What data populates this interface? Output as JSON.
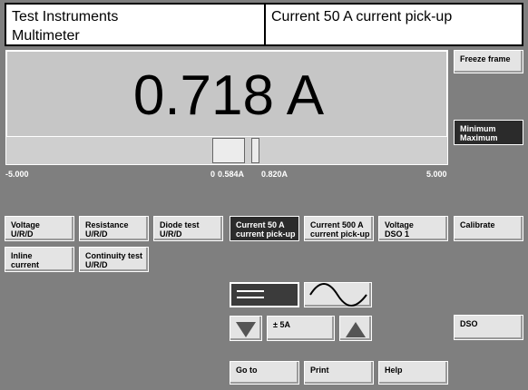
{
  "header": {
    "app_line1": "Test Instruments",
    "app_line2": "Multimeter",
    "mode_title": "Current 50 A current pick-up"
  },
  "display": {
    "reading": "0.718 A",
    "scale_min": "-5.000",
    "scale_zero": "0",
    "scale_min_marker": "0.584A",
    "scale_max_marker": "0.820A",
    "scale_max": "5.000"
  },
  "side": {
    "freeze_frame": "Freeze frame",
    "min_max_l1": "Minimum",
    "min_max_l2": "Maximum",
    "calibrate": "Calibrate",
    "dso": "DSO"
  },
  "modes": {
    "voltage_l1": "Voltage",
    "voltage_l2": "U/R/D",
    "resistance_l1": "Resistance",
    "resistance_l2": "U/R/D",
    "diode_l1": "Diode test",
    "diode_l2": "U/R/D",
    "cur50_l1": "Current 50 A",
    "cur50_l2": "current pick-up",
    "cur500_l1": "Current 500 A",
    "cur500_l2": "current pick-up",
    "voltdso_l1": "Voltage",
    "voltdso_l2": "DSO 1",
    "inline_l1": "Inline",
    "inline_l2": "current",
    "continuity_l1": "Continuity test",
    "continuity_l2": "U/R/D"
  },
  "range": {
    "value": "± 5A"
  },
  "footer": {
    "goto": "Go to",
    "print": "Print",
    "help": "Help"
  }
}
